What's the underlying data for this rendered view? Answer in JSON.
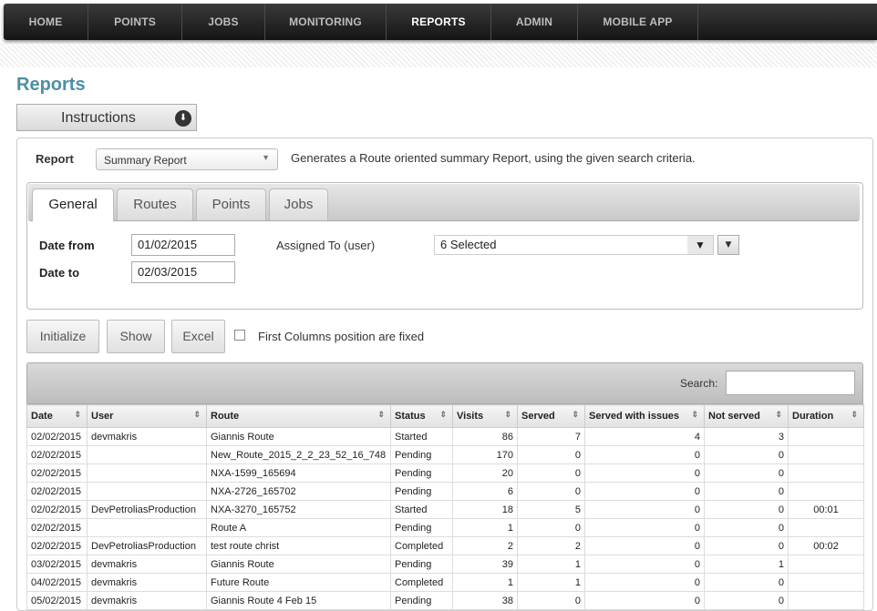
{
  "nav": {
    "items": [
      {
        "label": "HOME",
        "active": false
      },
      {
        "label": "POINTS",
        "active": false
      },
      {
        "label": "JOBS",
        "active": false
      },
      {
        "label": "MONITORING",
        "active": false
      },
      {
        "label": "REPORTS",
        "active": true
      },
      {
        "label": "ADMIN",
        "active": false
      },
      {
        "label": "MOBILE APP",
        "active": false
      }
    ]
  },
  "page": {
    "title": "Reports",
    "instructions_label": "Instructions",
    "instructions_icon": "download-circle-icon"
  },
  "report": {
    "label": "Report",
    "selected": "Summary Report",
    "description": "Generates a Route oriented summary Report, using the given search criteria."
  },
  "tabs": [
    {
      "label": "General",
      "active": true
    },
    {
      "label": "Routes",
      "active": false
    },
    {
      "label": "Points",
      "active": false
    },
    {
      "label": "Jobs",
      "active": false
    }
  ],
  "filters": {
    "date_from_label": "Date from",
    "date_from_value": "01/02/2015",
    "date_to_label": "Date to",
    "date_to_value": "02/03/2015",
    "assigned_label": "Assigned To (user)",
    "assigned_value": "6 Selected"
  },
  "actions": {
    "initialize": "Initialize",
    "show": "Show",
    "excel": "Excel",
    "fixed_columns_label": "First Columns position are fixed",
    "fixed_columns_checked": false
  },
  "table": {
    "search_label": "Search:",
    "search_value": "",
    "columns": [
      "Date",
      "User",
      "Route",
      "Status",
      "Visits",
      "Served",
      "Served with issues",
      "Not served",
      "Duration"
    ],
    "rows": [
      [
        "02/02/2015",
        "devmakris",
        "Giannis Route",
        "Started",
        "86",
        "7",
        "4",
        "3",
        ""
      ],
      [
        "02/02/2015",
        "",
        "New_Route_2015_2_2_23_52_16_748",
        "Pending",
        "170",
        "0",
        "0",
        "0",
        ""
      ],
      [
        "02/02/2015",
        "",
        "NXA-1599_165694",
        "Pending",
        "20",
        "0",
        "0",
        "0",
        ""
      ],
      [
        "02/02/2015",
        "",
        "NXA-2726_165702",
        "Pending",
        "6",
        "0",
        "0",
        "0",
        ""
      ],
      [
        "02/02/2015",
        "DevPetroliasProduction",
        "NXA-3270_165752",
        "Started",
        "18",
        "5",
        "0",
        "0",
        "00:01"
      ],
      [
        "02/02/2015",
        "",
        "Route A",
        "Pending",
        "1",
        "0",
        "0",
        "0",
        ""
      ],
      [
        "02/02/2015",
        "DevPetroliasProduction",
        "test route christ",
        "Completed",
        "2",
        "2",
        "0",
        "0",
        "00:02"
      ],
      [
        "03/02/2015",
        "devmakris",
        "Giannis Route",
        "Pending",
        "39",
        "1",
        "0",
        "1",
        ""
      ],
      [
        "04/02/2015",
        "devmakris",
        "Future Route",
        "Completed",
        "1",
        "1",
        "0",
        "0",
        ""
      ],
      [
        "05/02/2015",
        "devmakris",
        "Giannis Route 4 Feb 15",
        "Pending",
        "38",
        "0",
        "0",
        "0",
        ""
      ]
    ]
  }
}
